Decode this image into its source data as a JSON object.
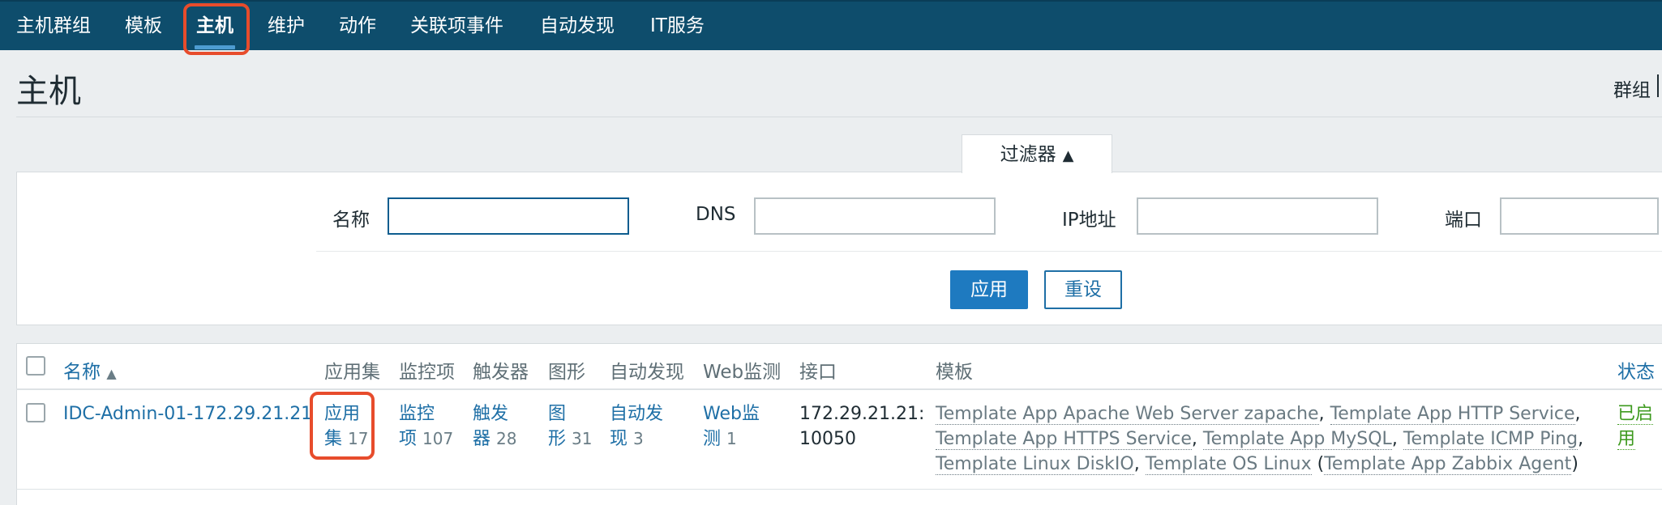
{
  "nav": {
    "items": [
      "主机群组",
      "模板",
      "主机",
      "维护",
      "动作",
      "关联项事件",
      "自动发现",
      "IT服务"
    ],
    "active_index": 2
  },
  "header": {
    "title": "主机",
    "right_label": "群组"
  },
  "filter": {
    "tab_label": "过滤器",
    "tab_arrow": "▲",
    "name_label": "名称",
    "name_value": "",
    "dns_label": "DNS",
    "dns_value": "",
    "ip_label": "IP地址",
    "ip_value": "",
    "port_label": "端口",
    "port_value": "",
    "apply_label": "应用",
    "reset_label": "重设"
  },
  "table": {
    "headers": {
      "name": "名称",
      "sort_arrow": "▲",
      "applications": "应用集",
      "items": "监控项",
      "triggers": "触发器",
      "graphs": "图形",
      "discovery": "自动发现",
      "web": "Web监测",
      "interface": "接口",
      "templates": "模板",
      "status": "状态"
    },
    "rows": [
      {
        "name": "IDC-Admin-01-172.29.21.21",
        "applications_line1": "应用",
        "applications_line2": "集",
        "applications_count": "17",
        "items_line1": "监控",
        "items_line2": "项",
        "items_count": "107",
        "triggers_line1": "触发",
        "triggers_line2": "器",
        "triggers_count": "28",
        "graphs_line1": "图",
        "graphs_line2": "形",
        "graphs_count": "31",
        "discovery_line1": "自动发",
        "discovery_line2": "现",
        "discovery_count": "3",
        "web_line1": "Web监",
        "web_line2": "测",
        "web_count": "1",
        "interface_line1": "172.29.21.21:",
        "interface_line2": "10050",
        "templates": [
          "Template App Apache Web Server zapache",
          "Template App HTTP Service",
          "Template App HTTPS Service",
          "Template App MySQL",
          "Template ICMP Ping",
          "Template Linux DiskIO",
          "Template OS Linux",
          "Template App Zabbix Agent"
        ],
        "status_line1": "已启",
        "status_line2": "用"
      }
    ]
  },
  "colors": {
    "nav_bg": "#0e4d6c",
    "link": "#1e6fa6",
    "primary_button": "#1e7ac0",
    "highlight": "#e74c2c",
    "status_enabled": "#3d9a1e"
  }
}
